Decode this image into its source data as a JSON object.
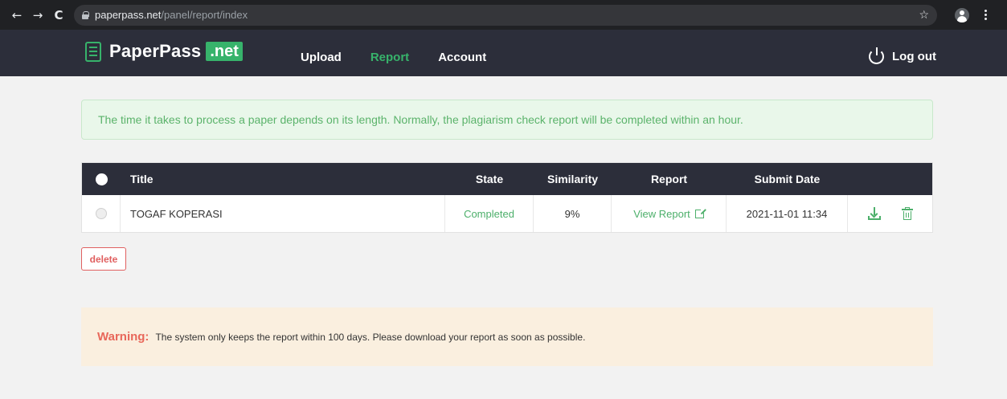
{
  "browser": {
    "back": "←",
    "forward": "→",
    "reload": "C",
    "url_host": "paperpass.net",
    "url_path": "/panel/report/index",
    "bookmark": "☆"
  },
  "header": {
    "logo_name": "PaperPass",
    "logo_badge": ".net",
    "nav": [
      {
        "label": "Upload"
      },
      {
        "label": "Report"
      },
      {
        "label": "Account"
      }
    ],
    "logout_label": "Log out"
  },
  "notice": "The time it takes to process a paper depends on its length. Normally, the plagiarism check report will be completed within an hour.",
  "table": {
    "columns": {
      "title": "Title",
      "state": "State",
      "similarity": "Similarity",
      "report": "Report",
      "submit_date": "Submit Date"
    },
    "rows": [
      {
        "title": "TOGAF KOPERASI",
        "state": "Completed",
        "similarity": "9%",
        "report_link": "View Report",
        "submit_date": "2021-11-01 11:34"
      }
    ]
  },
  "delete_label": "delete",
  "warning": {
    "label": "Warning:",
    "text": "The system only keeps the report within 100 days. Please download your report as soon as possible."
  },
  "colors": {
    "accent_green": "#37b36b",
    "header_bg": "#2c2e3a",
    "danger": "#e06060",
    "warning_bg": "#faefdf"
  }
}
